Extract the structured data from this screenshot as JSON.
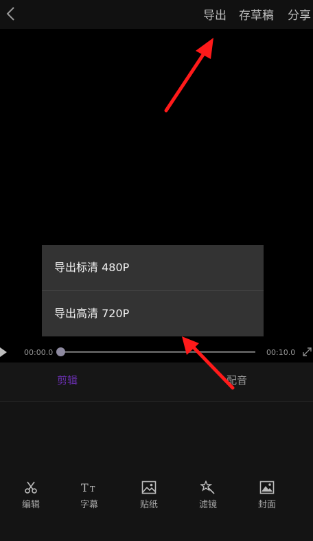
{
  "header": {
    "actions": [
      {
        "label": "导出"
      },
      {
        "label": "存草稿"
      },
      {
        "label": "分享"
      }
    ]
  },
  "export_menu": {
    "items": [
      {
        "label": "导出标清 480P"
      },
      {
        "label": "导出高清 720P"
      }
    ]
  },
  "player": {
    "current_time": "00:00.0",
    "total_time": "00:10.0",
    "progress": 0
  },
  "tabs": [
    {
      "label": "剪辑",
      "active": true
    },
    {
      "label": "配音",
      "active": false
    }
  ],
  "tools": [
    {
      "label": "编辑",
      "icon": "scissors-icon"
    },
    {
      "label": "字幕",
      "icon": "text-icon"
    },
    {
      "label": "贴纸",
      "icon": "sticker-icon"
    },
    {
      "label": "滤镜",
      "icon": "filter-wand-icon"
    },
    {
      "label": "封面",
      "icon": "cover-image-icon"
    }
  ],
  "colors": {
    "accent": "#6a2fb0",
    "arrow": "#ff1a1a"
  }
}
